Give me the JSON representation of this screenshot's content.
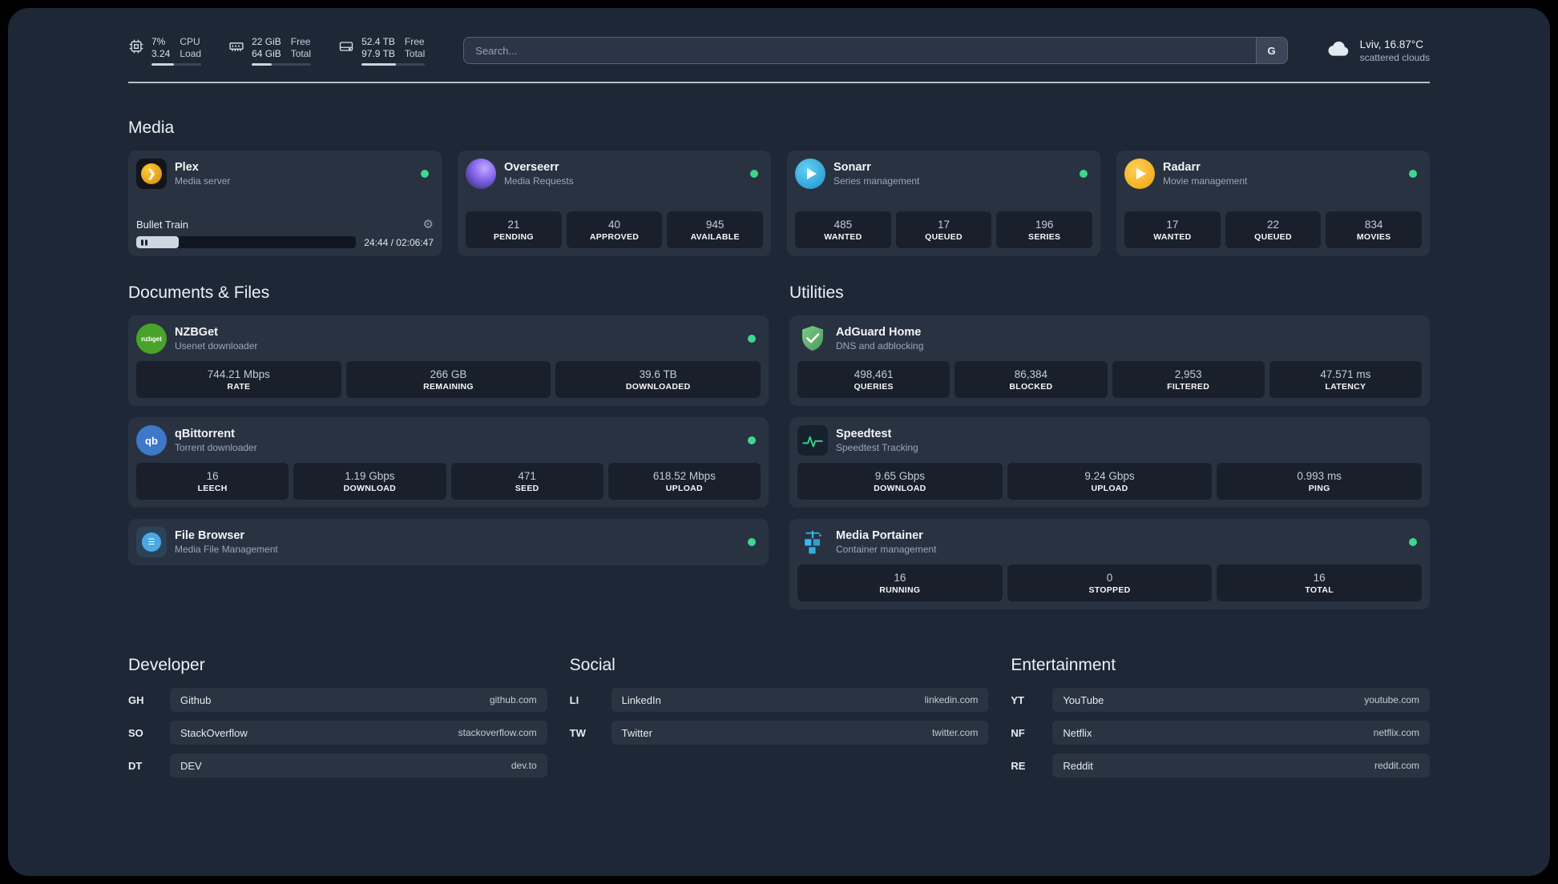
{
  "colors": {
    "status_online": "#3fd68f",
    "panel_bg": "#1d2736",
    "plex_accent": "#e5a00d"
  },
  "topbar": {
    "cpu": {
      "percent": "7%",
      "load": "3.24",
      "label_top": "CPU",
      "label_bottom": "Load",
      "bar_percent": 45
    },
    "memory": {
      "free": "22 GiB",
      "total": "64 GiB",
      "label_top": "Free",
      "label_bottom": "Total",
      "bar_percent": 34
    },
    "disk": {
      "free": "52.4 TB",
      "total": "97.9 TB",
      "label_top": "Free",
      "label_bottom": "Total",
      "bar_percent": 54
    },
    "search": {
      "placeholder": "Search...",
      "provider": "G"
    },
    "weather": {
      "location": "Lviv, 16.87°C",
      "condition": "scattered clouds"
    }
  },
  "media": {
    "title": "Media",
    "plex": {
      "name": "Plex",
      "desc": "Media server",
      "now_playing": "Bullet Train",
      "time": "24:44 / 02:06:47",
      "progress_percent": 19.5
    },
    "overseerr": {
      "name": "Overseerr",
      "desc": "Media Requests",
      "stats": [
        {
          "value": "21",
          "label": "PENDING"
        },
        {
          "value": "40",
          "label": "APPROVED"
        },
        {
          "value": "945",
          "label": "AVAILABLE"
        }
      ]
    },
    "sonarr": {
      "name": "Sonarr",
      "desc": "Series management",
      "stats": [
        {
          "value": "485",
          "label": "WANTED"
        },
        {
          "value": "17",
          "label": "QUEUED"
        },
        {
          "value": "196",
          "label": "SERIES"
        }
      ]
    },
    "radarr": {
      "name": "Radarr",
      "desc": "Movie management",
      "stats": [
        {
          "value": "17",
          "label": "WANTED"
        },
        {
          "value": "22",
          "label": "QUEUED"
        },
        {
          "value": "834",
          "label": "MOVIES"
        }
      ]
    }
  },
  "documents": {
    "title": "Documents & Files",
    "nzbget": {
      "name": "NZBGet",
      "desc": "Usenet downloader",
      "icon_text": "nzbget",
      "stats": [
        {
          "value": "744.21 Mbps",
          "label": "RATE"
        },
        {
          "value": "266 GB",
          "label": "REMAINING"
        },
        {
          "value": "39.6 TB",
          "label": "DOWNLOADED"
        }
      ]
    },
    "qbittorrent": {
      "name": "qBittorrent",
      "desc": "Torrent downloader",
      "icon_text": "qb",
      "stats": [
        {
          "value": "16",
          "label": "LEECH"
        },
        {
          "value": "1.19 Gbps",
          "label": "DOWNLOAD"
        },
        {
          "value": "471",
          "label": "SEED"
        },
        {
          "value": "618.52 Mbps",
          "label": "UPLOAD"
        }
      ]
    },
    "filebrowser": {
      "name": "File Browser",
      "desc": "Media File Management"
    }
  },
  "utilities": {
    "title": "Utilities",
    "adguard": {
      "name": "AdGuard Home",
      "desc": "DNS and adblocking",
      "stats": [
        {
          "value": "498,461",
          "label": "QUERIES"
        },
        {
          "value": "86,384",
          "label": "BLOCKED"
        },
        {
          "value": "2,953",
          "label": "FILTERED"
        },
        {
          "value": "47.571 ms",
          "label": "LATENCY"
        }
      ]
    },
    "speedtest": {
      "name": "Speedtest",
      "desc": "Speedtest Tracking",
      "stats": [
        {
          "value": "9.65 Gbps",
          "label": "DOWNLOAD"
        },
        {
          "value": "9.24 Gbps",
          "label": "UPLOAD"
        },
        {
          "value": "0.993 ms",
          "label": "PING"
        }
      ]
    },
    "portainer": {
      "name": "Media Portainer",
      "desc": "Container management",
      "stats": [
        {
          "value": "16",
          "label": "RUNNING"
        },
        {
          "value": "0",
          "label": "STOPPED"
        },
        {
          "value": "16",
          "label": "TOTAL"
        }
      ]
    }
  },
  "bookmarks": {
    "developer": {
      "title": "Developer",
      "items": [
        {
          "abbr": "GH",
          "name": "Github",
          "url": "github.com"
        },
        {
          "abbr": "SO",
          "name": "StackOverflow",
          "url": "stackoverflow.com"
        },
        {
          "abbr": "DT",
          "name": "DEV",
          "url": "dev.to"
        }
      ]
    },
    "social": {
      "title": "Social",
      "items": [
        {
          "abbr": "LI",
          "name": "LinkedIn",
          "url": "linkedin.com"
        },
        {
          "abbr": "TW",
          "name": "Twitter",
          "url": "twitter.com"
        }
      ]
    },
    "entertainment": {
      "title": "Entertainment",
      "items": [
        {
          "abbr": "YT",
          "name": "YouTube",
          "url": "youtube.com"
        },
        {
          "abbr": "NF",
          "name": "Netflix",
          "url": "netflix.com"
        },
        {
          "abbr": "RE",
          "name": "Reddit",
          "url": "reddit.com"
        }
      ]
    }
  }
}
